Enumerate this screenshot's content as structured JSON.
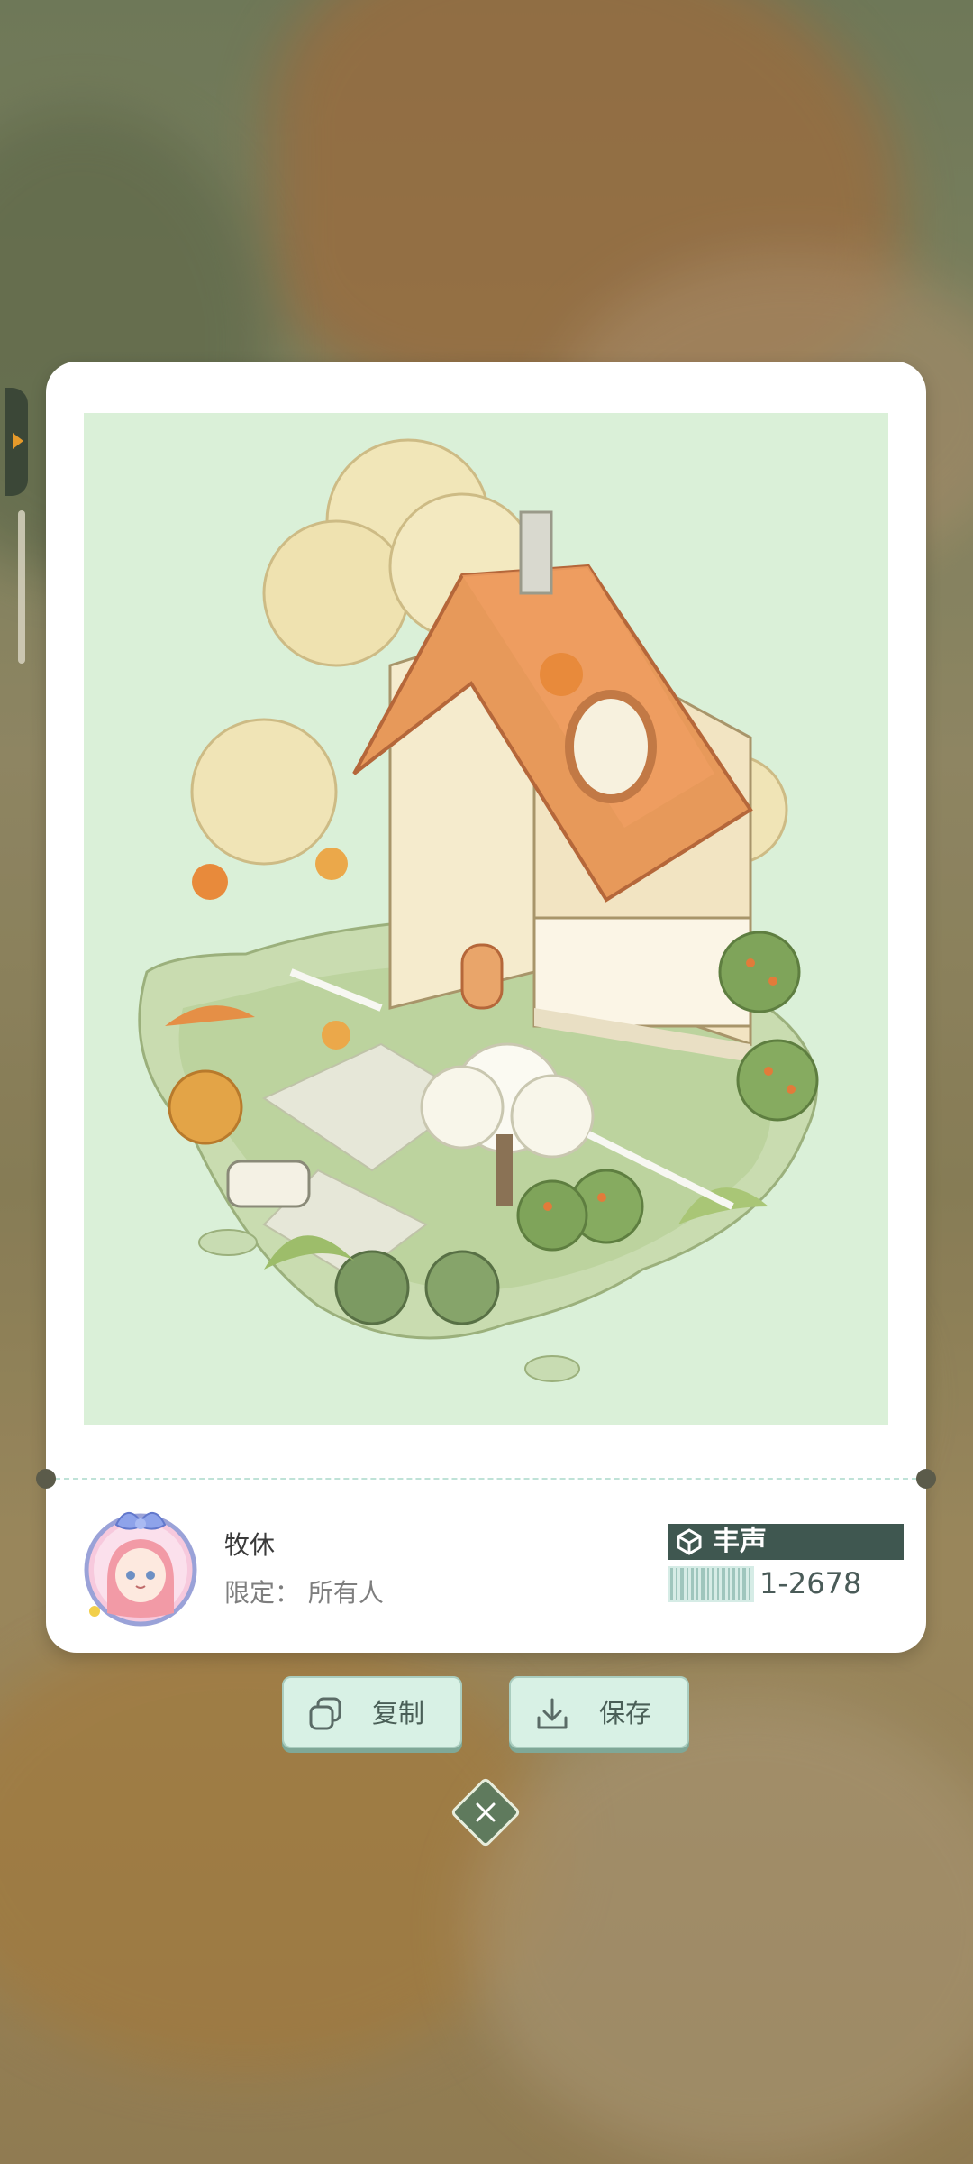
{
  "author": {
    "name": "牧休",
    "limit_label": "限定：",
    "limit_value": "所有人"
  },
  "badge": {
    "label": "丰声",
    "serial": "1-2678"
  },
  "actions": {
    "copy_label": "复制",
    "save_label": "保存"
  },
  "icons": {
    "copy": "copy-icon",
    "save": "download-icon",
    "close": "close-icon",
    "badge": "cube-icon"
  },
  "colors": {
    "card_bg": "#ffffff",
    "preview_bg": "#daf0d8",
    "badge_bg": "#3f5750",
    "button_bg": "#d8f1e5",
    "close_bg": "#5f7a5d"
  }
}
